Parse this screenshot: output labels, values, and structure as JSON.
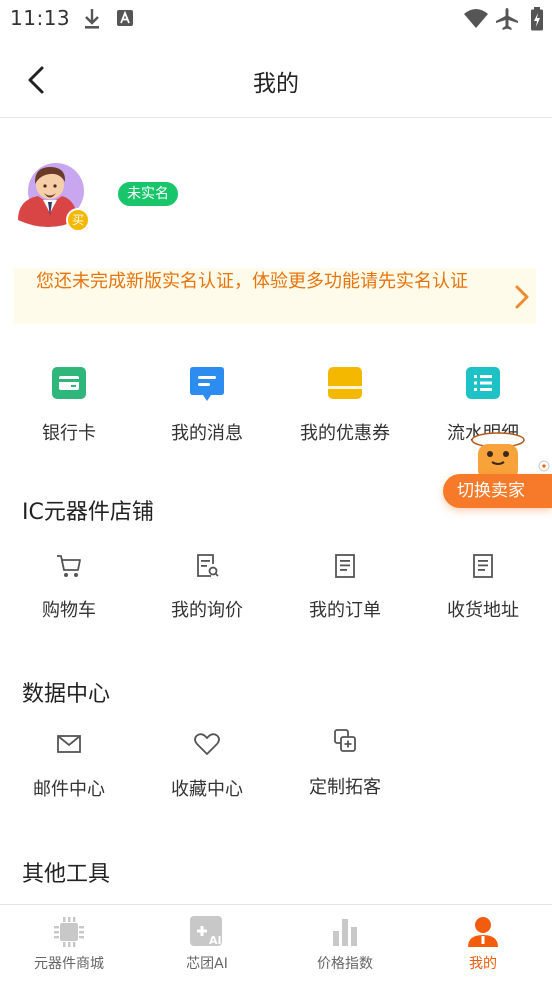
{
  "status_bar": {
    "time": "11:13"
  },
  "header": {
    "title": "我的"
  },
  "profile": {
    "buyer_badge": "买",
    "verify_status": "未实名"
  },
  "notice": {
    "text": "您还未完成新版实名认证，体验更多功能请先实名认证"
  },
  "quick_links": [
    {
      "label": "银行卡",
      "icon": "bank-card-icon",
      "color": "#2fb67a"
    },
    {
      "label": "我的消息",
      "icon": "message-icon",
      "color": "#2d8cf0"
    },
    {
      "label": "我的优惠券",
      "icon": "coupon-icon",
      "color": "#f5b800"
    },
    {
      "label": "流水明细",
      "icon": "statement-icon",
      "color": "#1dc2c7"
    }
  ],
  "store_section": {
    "title": "IC元器件店铺",
    "items": [
      {
        "label": "购物车",
        "icon": "cart-icon"
      },
      {
        "label": "我的询价",
        "icon": "inquiry-icon"
      },
      {
        "label": "我的订单",
        "icon": "order-icon"
      },
      {
        "label": "收货地址",
        "icon": "address-icon"
      }
    ]
  },
  "data_section": {
    "title": "数据中心",
    "items": [
      {
        "label": "邮件中心",
        "icon": "mail-icon"
      },
      {
        "label": "收藏中心",
        "icon": "heart-icon"
      },
      {
        "label": "定制拓客",
        "icon": "customize-icon"
      }
    ]
  },
  "tools_section": {
    "title": "其他工具"
  },
  "seller_switch": {
    "label": "切换卖家"
  },
  "bottom_nav": [
    {
      "label": "元器件商城",
      "icon": "chip-icon",
      "active": false
    },
    {
      "label": "芯团AI",
      "icon": "ai-icon",
      "active": false
    },
    {
      "label": "价格指数",
      "icon": "bar-chart-icon",
      "active": false
    },
    {
      "label": "我的",
      "icon": "user-icon",
      "active": true
    }
  ],
  "colors": {
    "accent": "#f25c0d",
    "notice_text": "#e8740c",
    "verify_green": "#19c56a",
    "switch_orange": "#f77a2a"
  }
}
